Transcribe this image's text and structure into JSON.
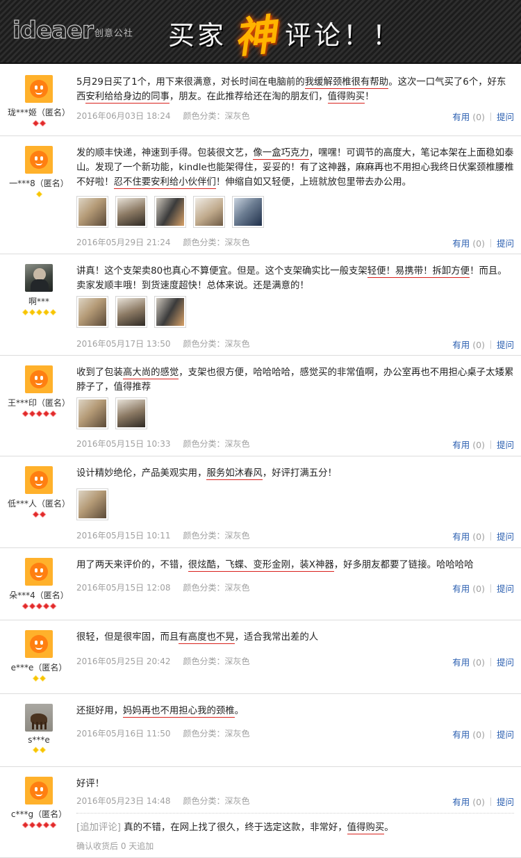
{
  "banner": {
    "logo_word": "ideaer",
    "logo_sub": "创意公社",
    "title_before": "买家",
    "title_god": "神",
    "title_after": "评论！！"
  },
  "colors": {
    "highlight_underline": "#d9201b",
    "link_blue": "#2b5fb0",
    "meta_gray": "#a0a0a0",
    "god_orange": "#ffb400"
  },
  "actions": {
    "useful": "有用",
    "count": "(0)",
    "ask": "提问"
  },
  "reviews": [
    {
      "user": "珑***姬（匿名）",
      "avatar": "default-avatar",
      "badge_type": "heart",
      "badge_count": 2,
      "segments": [
        {
          "t": "5月29日买了1个，用下来很满意，对长时间在电脑前的"
        },
        {
          "t": "我缓解颈椎很有帮助",
          "hl": true
        },
        {
          "t": "。这次一口气买了6个，好东西"
        },
        {
          "t": "安利给给身边的同事",
          "hl": true
        },
        {
          "t": "，朋友。在此推荐给还在淘的朋友们，"
        },
        {
          "t": "值得购买",
          "hl": true
        },
        {
          "t": "！"
        }
      ],
      "photos": [],
      "date": "2016年06月03日 18:24",
      "category": "颜色分类：深灰色"
    },
    {
      "user": "一***8（匿名）",
      "avatar": "default-avatar",
      "badge_type": "diamond",
      "badge_count": 1,
      "segments": [
        {
          "t": "发的顺丰快递，神速到手得。包装很文艺，"
        },
        {
          "t": "像一盒巧克力",
          "hl": true
        },
        {
          "t": "，嘿嘿！可调节的高度大，笔记本架在上面稳如泰山。发现了一个新功能，kindle也能架得住，妥妥的！有了这神器，麻麻再也不用担心我终日伏案颈椎腰椎不好啦！"
        },
        {
          "t": "忍不住要安利给小伙伴们",
          "hl": true
        },
        {
          "t": "！伸缩自如又轻便，上班就放包里带去办公用。"
        }
      ],
      "photos": [
        "photo-1",
        "photo-2",
        "photo-3",
        "photo-4",
        "photo-5"
      ],
      "date": "2016年05月29日 21:24",
      "category": "颜色分类：深灰色"
    },
    {
      "user": "啊***",
      "avatar": "photo-avatar",
      "badge_type": "diamond",
      "badge_count": 5,
      "segments": [
        {
          "t": "讲真！这个支架卖80也真心不算便宜。但是。这个支架确实比一般支架"
        },
        {
          "t": "轻便！易携带！拆卸方便",
          "hl": true
        },
        {
          "t": "！而且。卖家发顺丰哦！到货速度超快！总体来说。还是满意的！"
        }
      ],
      "photos": [
        "photo-1",
        "photo-2",
        "photo-3"
      ],
      "date": "2016年05月17日 13:50",
      "category": "颜色分类：深灰色"
    },
    {
      "user": "王***印（匿名）",
      "avatar": "default-avatar",
      "badge_type": "heart",
      "badge_count": 5,
      "segments": [
        {
          "t": "收到了包装"
        },
        {
          "t": "高大尚的感觉",
          "hl": true
        },
        {
          "t": "，支架也很方便，哈哈哈哈，感觉买的非常值啊，办公室再也不用担心桌子太矮累脖子了，值得推荐"
        }
      ],
      "photos": [
        "photo-1",
        "photo-2"
      ],
      "date": "2016年05月15日 10:33",
      "category": "颜色分类：深灰色"
    },
    {
      "user": "低***人（匿名）",
      "avatar": "default-avatar",
      "badge_type": "heart",
      "badge_count": 2,
      "segments": [
        {
          "t": "设计精妙绝伦，产品美观实用，"
        },
        {
          "t": "服务如沐春风",
          "hl": true
        },
        {
          "t": "，好评打满五分！"
        }
      ],
      "photos": [
        "photo-1"
      ],
      "date": "2016年05月15日 10:11",
      "category": "颜色分类：深灰色"
    },
    {
      "user": "朵***4（匿名）",
      "avatar": "default-avatar",
      "badge_type": "heart",
      "badge_count": 5,
      "segments": [
        {
          "t": "用了两天来评价的，不错，"
        },
        {
          "t": "很炫酷，飞蝶、变形金刚，装X神器",
          "hl": true
        },
        {
          "t": "，好多朋友都要了链接。哈哈哈哈"
        }
      ],
      "photos": [],
      "date": "2016年05月15日 12:08",
      "category": "颜色分类：深灰色"
    },
    {
      "user": "e***e（匿名）",
      "avatar": "default-avatar",
      "badge_type": "diamond",
      "badge_count": 2,
      "segments": [
        {
          "t": "很轻，但是很牢固，而且"
        },
        {
          "t": "有高度也不晃",
          "hl": true
        },
        {
          "t": "，适合我常出差的人"
        }
      ],
      "photos": [],
      "date": "2016年05月25日 20:42",
      "category": "颜色分类：深灰色"
    },
    {
      "user": "s***e",
      "avatar": "critter-avatar",
      "badge_type": "diamond",
      "badge_count": 2,
      "segments": [
        {
          "t": "还挺好用，"
        },
        {
          "t": "妈妈再也不用担心我的颈椎",
          "hl": true
        },
        {
          "t": "。"
        }
      ],
      "photos": [],
      "date": "2016年05月16日 11:50",
      "category": "颜色分类：深灰色"
    },
    {
      "user": "c***g（匿名）",
      "avatar": "default-avatar",
      "badge_type": "heart",
      "badge_count": 5,
      "segments": [
        {
          "t": "好评！"
        }
      ],
      "photos": [],
      "date": "2016年05月23日 14:48",
      "category": "颜色分类：深灰色",
      "append": {
        "tag": "[追加评论]",
        "segments": [
          {
            "t": " 真的不错，在网上找了很久，终于选定这款，非常好，"
          },
          {
            "t": "值得购买",
            "hl": true
          },
          {
            "t": "。"
          }
        ],
        "foot": "确认收货后 0 天追加"
      }
    }
  ]
}
